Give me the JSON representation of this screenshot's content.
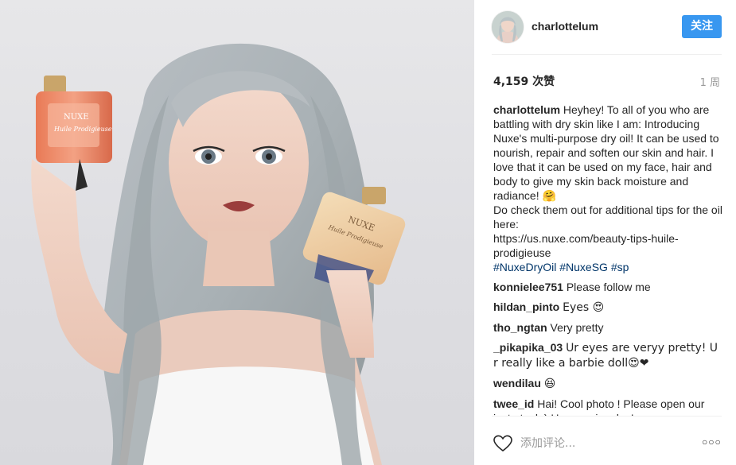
{
  "post": {
    "author": "charlottelum",
    "follow_label": "关注",
    "likes": "4,159 次赞",
    "time_ago": "1 周",
    "caption_user": "charlottelum",
    "caption_text": "Heyhey! To all of you who are battling with dry skin like I am: Introducing Nuxe's multi-purpose dry oil! It can be used to nourish, repair and soften our skin and hair. I love that it can be used on my face, hair and body to give my skin back moisture and radiance! 🤗",
    "caption_text2": "Do check them out for additional tips for the oil here:",
    "caption_link": "https://us.nuxe.com/beauty-tips-huile-prodigieuse",
    "hashtags": [
      "#NuxeDryOil",
      "#NuxeSG",
      "#sp"
    ]
  },
  "comments": [
    {
      "user": "konnielee751",
      "text": "Please follow me"
    },
    {
      "user": "hildan_pinto",
      "text": "Eyes 😍"
    },
    {
      "user": "tho_ngtan",
      "text": "Very pretty"
    },
    {
      "user": "_pikapika_03",
      "text": "Ur eyes are veryy pretty! U r really like a barbie doll😍❤"
    },
    {
      "user": "wendilau",
      "text": "😆"
    },
    {
      "user": "twee_id",
      "text": "Hai! Cool photo ! Please open our insta toel :) Have a nice day!"
    }
  ],
  "footer": {
    "comment_placeholder": "添加评论...",
    "more_glyph": "○○○",
    "like_icon": "heart-outline-icon"
  },
  "photo": {
    "left_bottle_label": "NUXE",
    "left_bottle_sub": "Huile Prodigieuse",
    "right_bottle_label": "NUXE",
    "right_bottle_sub": "Huile Prodigieuse"
  },
  "colors": {
    "follow_button": "#3897f0",
    "hashtag": "#003569",
    "muted": "#999999"
  }
}
